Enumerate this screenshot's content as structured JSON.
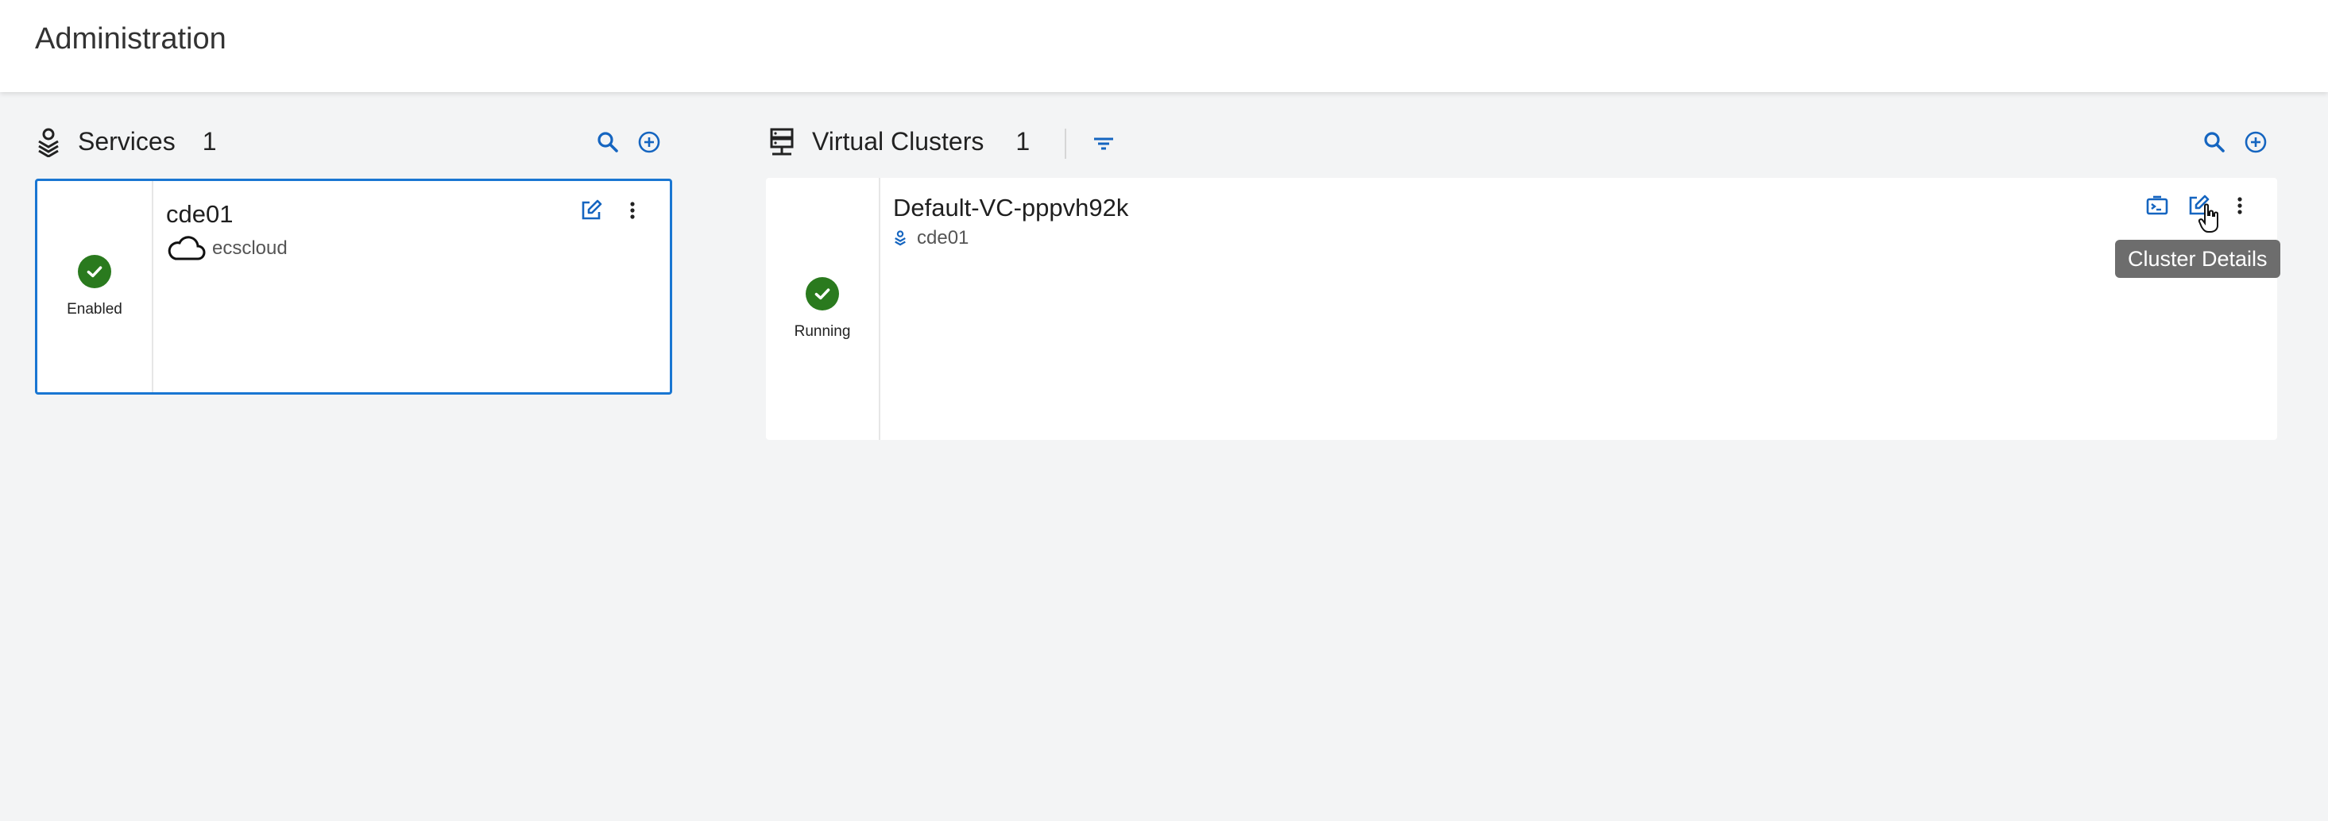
{
  "header": {
    "title": "Administration"
  },
  "services": {
    "label": "Services",
    "count": "1",
    "card": {
      "name": "cde01",
      "cloud": "ecscloud",
      "status": "Enabled"
    }
  },
  "virtual_clusters": {
    "label": "Virtual Clusters",
    "count": "1",
    "card": {
      "name": "Default-VC-pppvh92k",
      "service": "cde01",
      "status": "Running"
    },
    "tooltip": "Cluster Details"
  },
  "colors": {
    "accent": "#1565c0",
    "success": "#2a7a1e",
    "selected_border": "#1976d2"
  },
  "icons": {
    "services": "services-icon",
    "virtual_clusters": "server-icon",
    "search": "search-icon",
    "add": "add-circle-icon",
    "filter": "filter-icon",
    "edit": "edit-icon",
    "kebab": "more-vert-icon",
    "terminal": "terminal-icon",
    "cloud": "cloud-icon",
    "check": "check-icon",
    "cursor": "hand-pointer-icon"
  }
}
